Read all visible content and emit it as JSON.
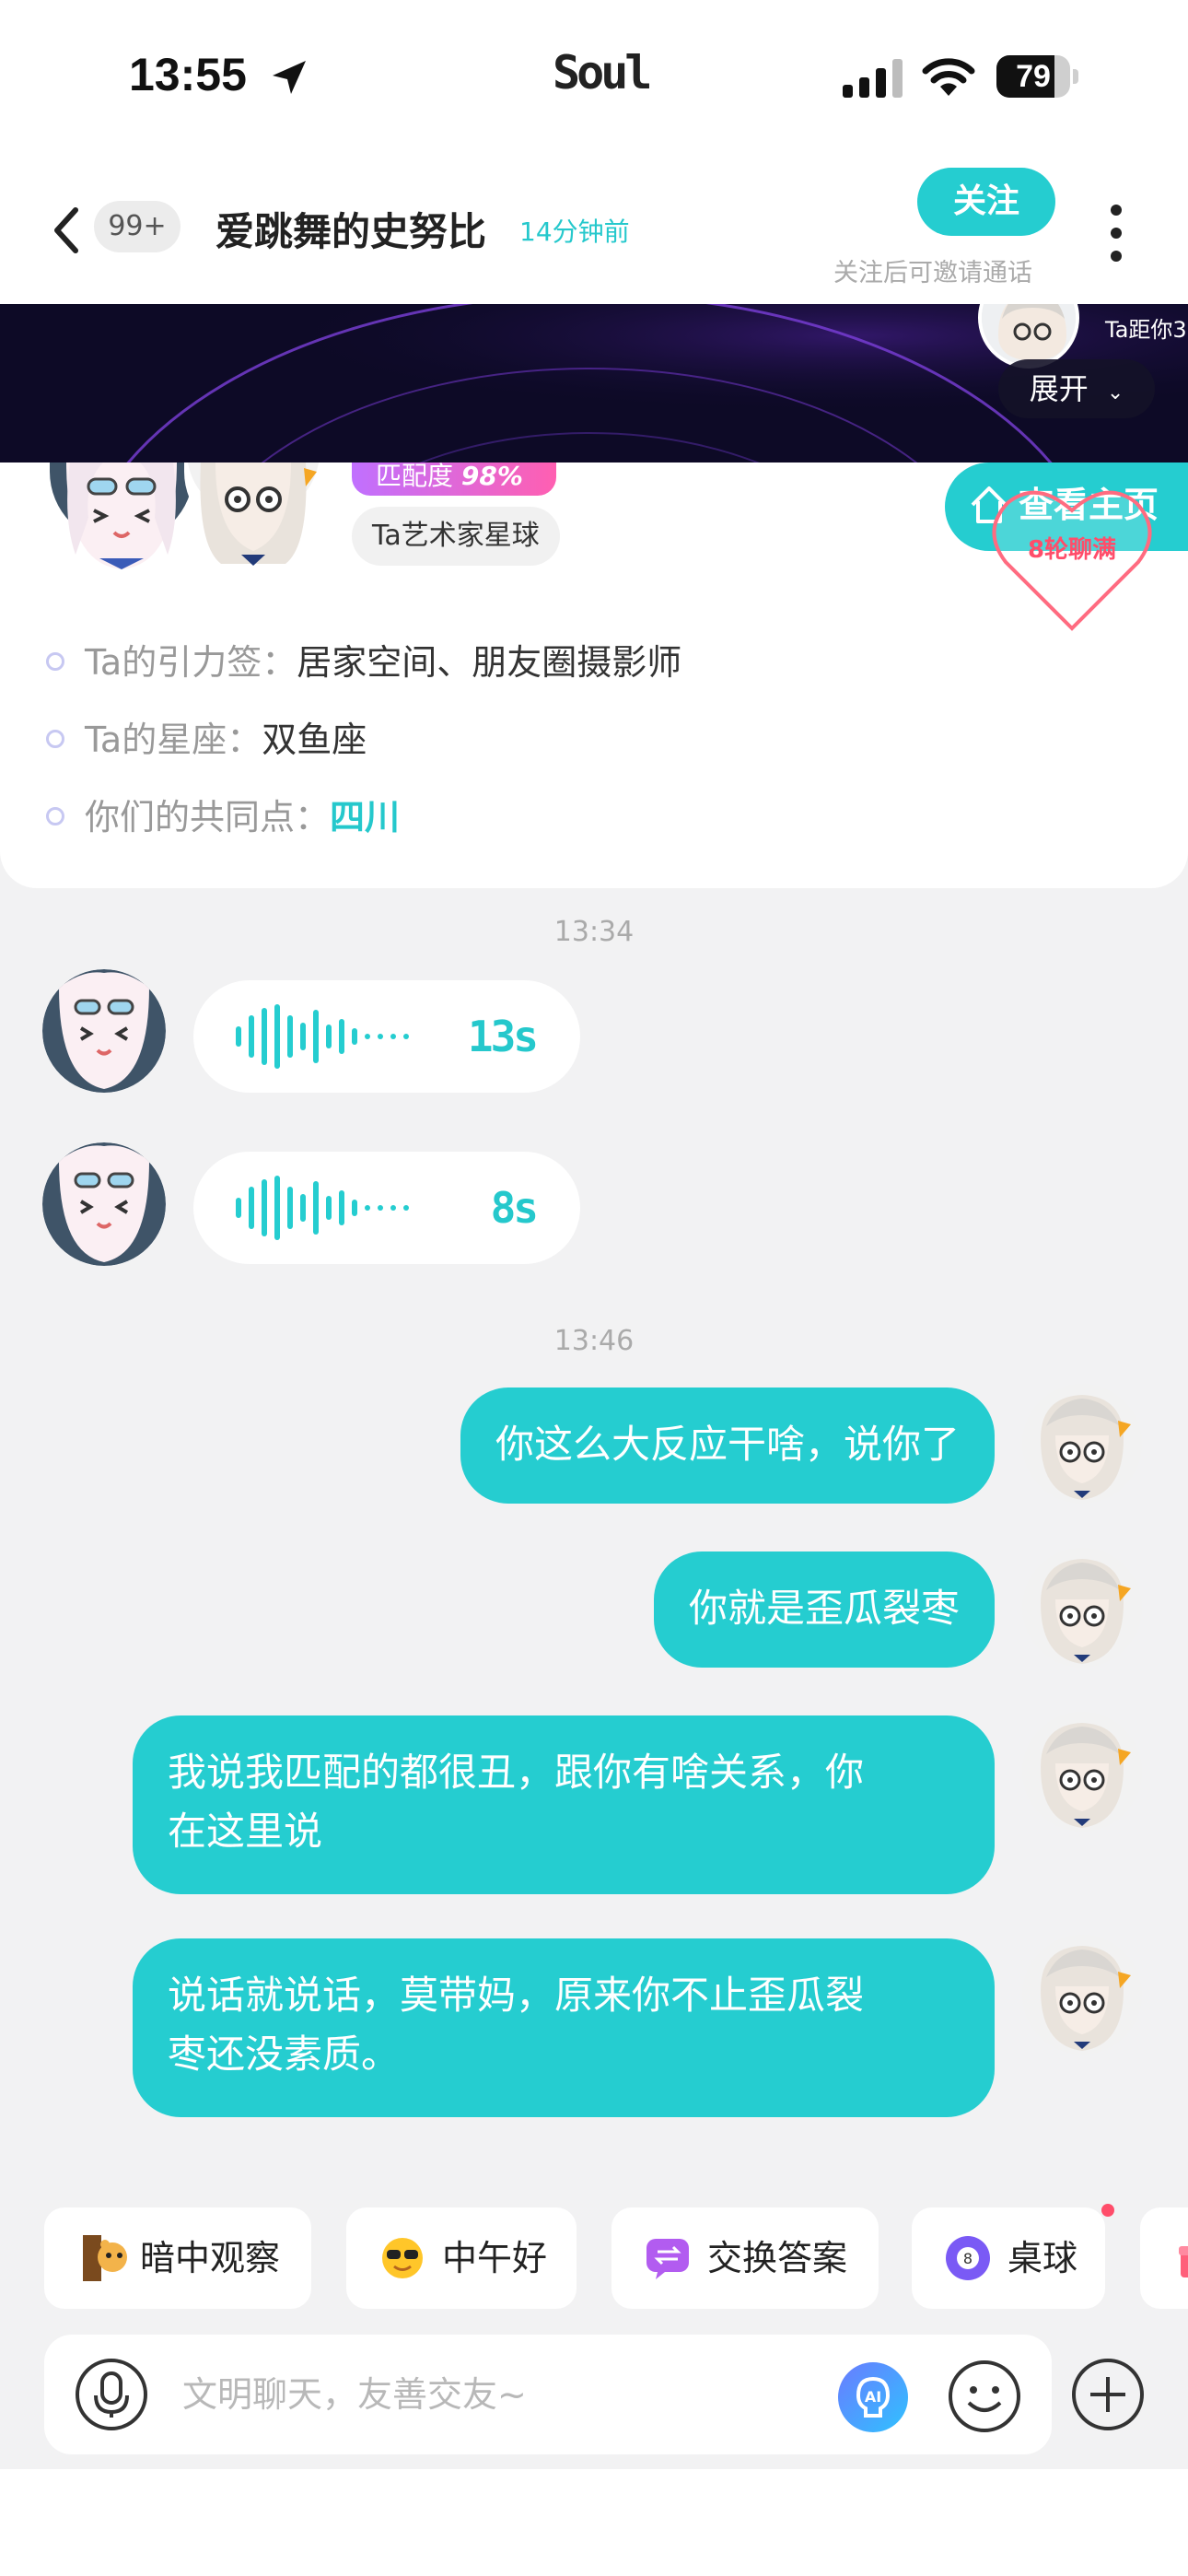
{
  "status_bar": {
    "time": "13:55",
    "app_name": "Soul",
    "battery_level": 79,
    "battery_text": "79"
  },
  "header": {
    "unread_count": "99+",
    "chat_name": "爱跳舞的史努比",
    "last_active": "14分钟前",
    "follow_label": "关注",
    "follow_hint": "关注后可邀请通话"
  },
  "banner": {
    "distance_text": "Ta距你3",
    "expand_label": "展开"
  },
  "profile": {
    "match_label": "匹配度",
    "match_value": "98%",
    "planet_tag": "Ta艺术家星球",
    "homepage_label": "查看主页",
    "heart_badge": "8轮聊满",
    "info": [
      {
        "label": "Ta的引力签：",
        "value": "居家空间、朋友圈摄影师"
      },
      {
        "label": "Ta的星座：",
        "value": "双鱼座"
      },
      {
        "label": "你们的共同点：",
        "value": "四川"
      }
    ]
  },
  "messages": {
    "timestamp_1": "13:34",
    "voice_1_duration": "13s",
    "voice_2_duration": "8s",
    "timestamp_2": "13:46",
    "text_1": "你这么大反应干啥，说你了",
    "text_2": "你就是歪瓜裂枣",
    "text_3_line1": "我说我匹配的都很丑，跟你有啥关系，你",
    "text_3_line2": "在这里说",
    "text_4_line1": "说话就说话，莫带妈，原来你不止歪瓜裂",
    "text_4_line2": "枣还没素质。"
  },
  "quick_actions": [
    {
      "label": "暗中观察",
      "icon": "peek-bear-icon"
    },
    {
      "label": "中午好",
      "icon": "sunglasses-emoji-icon"
    },
    {
      "label": "交换答案",
      "icon": "exchange-chat-icon"
    },
    {
      "label": "桌球",
      "icon": "billiard-ball-icon"
    }
  ],
  "input": {
    "placeholder": "文明聊天，友善交友~"
  },
  "colors": {
    "accent": "#25cdd0",
    "match_gradient_start": "#c070ff",
    "match_gradient_end": "#ff5fb1",
    "heart": "#ff4d6a",
    "banner": "#0d0a26"
  }
}
